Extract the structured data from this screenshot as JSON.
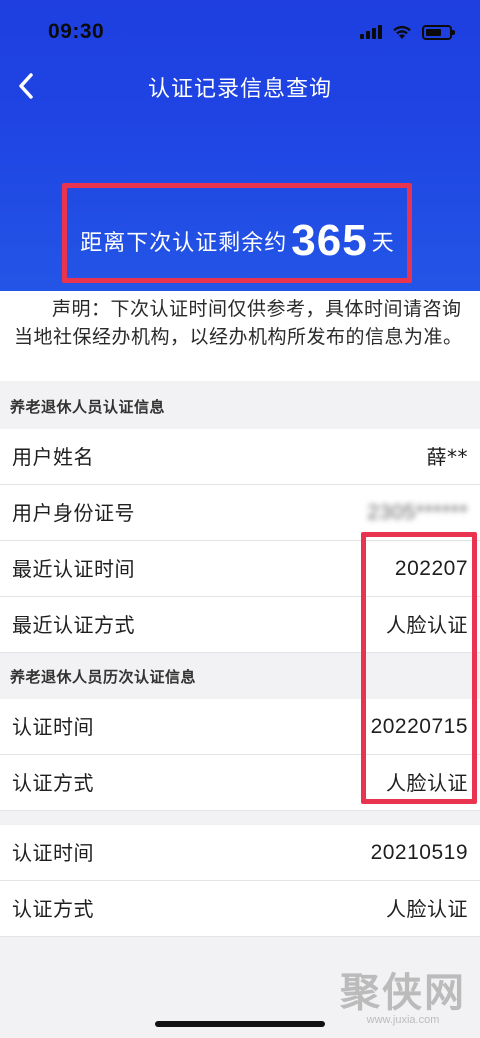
{
  "status_bar": {
    "time": "09:30"
  },
  "nav": {
    "title": "认证记录信息查询"
  },
  "countdown": {
    "prefix": "距离下次认证剩余约",
    "days": "365",
    "suffix": "天"
  },
  "notice": "声明：下次认证时间仅供参考，具体时间请咨询当地社保经办机构，以经办机构所发布的信息为准。",
  "sections": {
    "certification_info": {
      "title": "养老退休人员认证信息",
      "rows": [
        {
          "label": "用户姓名",
          "value": "薛**"
        },
        {
          "label": "用户身份证号",
          "value": "2305******"
        },
        {
          "label": "最近认证时间",
          "value": "202207"
        },
        {
          "label": "最近认证方式",
          "value": "人脸认证"
        }
      ]
    },
    "history": {
      "title": "养老退休人员历次认证信息",
      "records": [
        {
          "time_label": "认证时间",
          "time_value": "20220715",
          "method_label": "认证方式",
          "method_value": "人脸认证"
        },
        {
          "time_label": "认证时间",
          "time_value": "20210519",
          "method_label": "认证方式",
          "method_value": "人脸认证"
        }
      ]
    }
  },
  "watermark": {
    "logo": "聚侠网",
    "url": "www.juxia.com"
  },
  "colors": {
    "header_blue": "#1f44e3",
    "highlight_red": "#e8344e",
    "background": "#f2f2f4"
  }
}
